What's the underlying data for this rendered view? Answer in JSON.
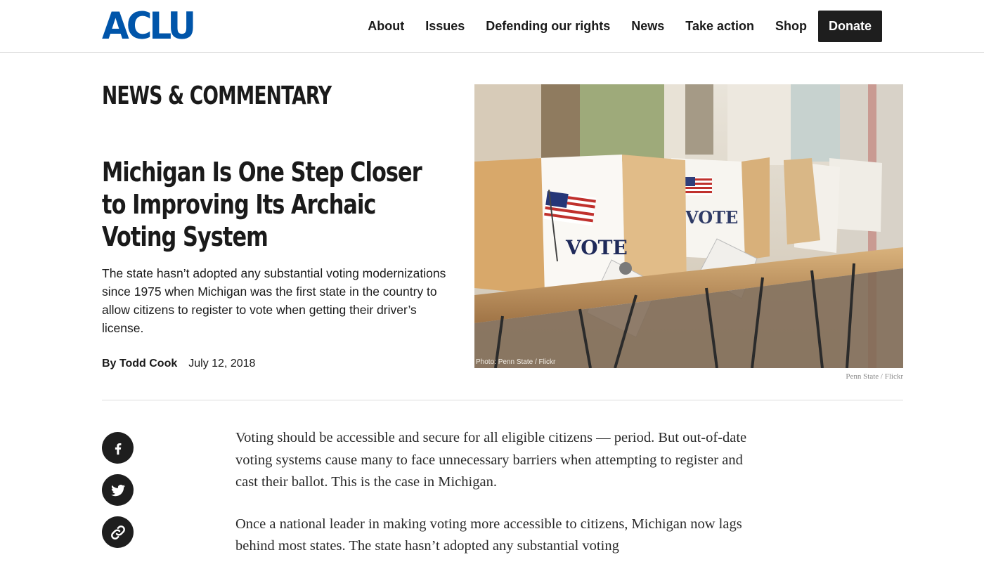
{
  "header": {
    "logo_text": "ACLU",
    "logo_color": "#0055aa",
    "nav": [
      "About",
      "Issues",
      "Defending our rights",
      "News",
      "Take action",
      "Shop"
    ],
    "donate_label": "Donate"
  },
  "article": {
    "eyebrow": "NEWS & COMMENTARY",
    "headline": "Michigan Is One Step Closer to Improving Its Archaic Voting System",
    "summary": "The state hasn’t adopted any substantial voting modernizations since 1975 when Michigan was the first state in the country to allow citizens to register to vote when getting their driver’s license.",
    "author": "By Todd Cook",
    "date": "July 12, 2018",
    "photo_overlay_credit": "Photo: Penn State  / Flickr",
    "photo_caption": "Penn State / Flickr",
    "booth_label": "VOTE",
    "body": [
      "Voting should be accessible and secure for all eligible citizens — period. But out-of-date voting systems cause many to face unnecessary barriers when attempting to register and cast their ballot. This is the case in Michigan.",
      "Once a national leader in making voting more accessible to citizens, Michigan now lags behind most states. The state hasn’t adopted any substantial voting"
    ]
  },
  "social": [
    "facebook-icon",
    "twitter-icon",
    "link-icon"
  ]
}
